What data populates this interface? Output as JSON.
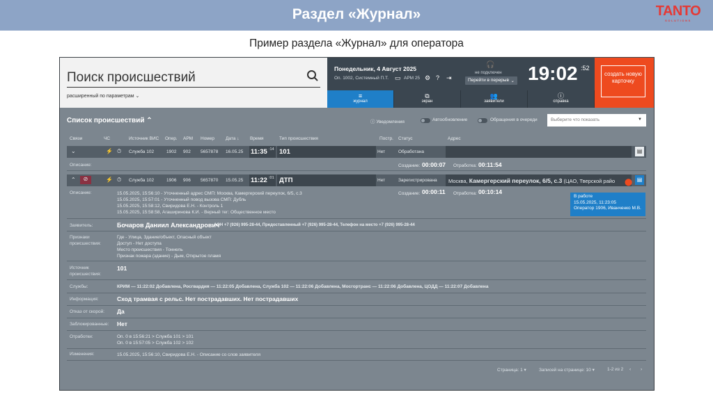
{
  "slide": {
    "title": "Раздел «Журнал»",
    "subtitle": "Пример раздела «Журнал» для оператора",
    "brand": "TANTO",
    "brand_sub": "SOLUTIONS"
  },
  "header": {
    "search_title": "Поиск происшествий",
    "advanced_search": "расширенный по параметрам",
    "date": "Понедельник, 4 Август 2025",
    "operator": "Оп. 1002, Системный П.Т.",
    "arm": "АРМ 25",
    "headset_status": "не подключен",
    "pause_label": "Перейти в перерыв",
    "clock_hm": "19:02",
    "clock_sec": ":52",
    "create_card": "создать новую карточку"
  },
  "tabs": [
    {
      "label": "журнал",
      "icon": "list-icon",
      "active": true
    },
    {
      "label": "экран",
      "icon": "external-screen-icon",
      "active": false
    },
    {
      "label": "заявители",
      "icon": "users-icon",
      "active": false
    },
    {
      "label": "справка",
      "icon": "help-icon",
      "active": false
    }
  ],
  "list": {
    "title": "Список происшествий",
    "notifications": "Уведомления",
    "autoupdate": "Автообновление",
    "queue": "Обращения в очереди",
    "select_placeholder": "Выберите что показать"
  },
  "columns": [
    "Связи",
    "ЧС",
    "Источник ВИС",
    "Опер.",
    "АРМ",
    "Номер",
    "Дата",
    "Время",
    "Тип происшествия",
    "Постр.",
    "Статус",
    "Адрес"
  ],
  "row1": {
    "source": "Служба 102",
    "oper": "1902",
    "arm": "902",
    "number": "5657878",
    "date": "16.05.25",
    "time": "11:35",
    "time_sec": ":14",
    "type": "101",
    "postr": "Нет",
    "status": "Обработана",
    "desc_label": "Описание:",
    "created_label": "Создание:",
    "created": "00:00:07",
    "processing_label": "Отработка:",
    "processing": "00:11:54"
  },
  "row2": {
    "source": "Служба 102",
    "oper": "1906",
    "arm": "906",
    "number": "5657870",
    "date": "15.05.25",
    "time": "11:22",
    "time_sec": ":01",
    "type": "ДТП",
    "postr": "Нет",
    "status": "Зарегистрирована",
    "address_prefix": "Москва,",
    "address_main": "Камергерский переулок, 6/5, с.3",
    "address_suffix": "(ЦАО, Тверской райо",
    "created_label": "Создание:",
    "created": "00:00:11",
    "processing_label": "Отработка:",
    "processing": "00:10:14",
    "tooltip": [
      "В работе",
      "15.05.2025, 11:23:05",
      "Оператор 1906, Иванченко М.В."
    ],
    "desc_label": "Описание:",
    "desc_lines": [
      "15.05.2025, 15:56:10 - Уточненный адрес СМП: Москва, Камергерский переулок, 6/5, с.3",
      "15.05.2025, 15:57:01 - Уточненный повод вызова СМП: Дубль",
      "15.05.2025, 15:58:12, Свиридова Е.Н. - Контроль 1",
      "15.05.2025, 15:58:58, Агаширинова К.И. - Верный тег: Общественное место"
    ],
    "applicant_label": "Заявитель:",
    "applicant": "Бочаров Даниил Александрович",
    "applicant_phones": "АОН +7 (926) 995-28-44, Предоставленный +7 (926) 995-28-44, Телефон на место +7 (926) 995-28-44",
    "signs_label": "Признаки происшествия:",
    "signs": [
      "Где - Улица, Здание/объект, Опасный объект",
      "Доступ - Нет доступа",
      "Место происшествия - Тоннель",
      "Признак пожара (здание) - Дым, Открытое пламя"
    ],
    "source_label": "Источник происшествия:",
    "source_value": "101",
    "services_label": "Службы:",
    "services": "КРИМ — 11:22:02 Добавлена, Росгвардия — 11:22:05 Добавлена, Служба 102 — 11:22:06 Добавлена, Мосгортранс — 11:22:06 Добавлена, ЦОДД — 11:22:07 Добавлена",
    "info_label": "Информация:",
    "info": "Сход трамвая с рельс. Нет пострадавших. Нет пострадавших",
    "ambulance_label": "Отказ от скорой:",
    "ambulance": "Да",
    "blocked_label": "Заблокированные:",
    "blocked": "Нет",
    "processing2_label": "Отработки:",
    "processing2": [
      "Оп. 0 в 15:56:21 > Служба 101 > 101",
      "Оп. 0 в 15:57:05 > Служба 102 > 102"
    ],
    "changes_label": "Изменения:",
    "changes": "15.05.2025, 15:56:10, Свиридова Е.Н. - Описание со слов заявителя"
  },
  "pager": {
    "page": "Страница: 1",
    "per_page": "Записей на странице: 10",
    "range": "1-2 из 2"
  },
  "colors": {
    "accent": "#1f7fc8",
    "create": "#ee4a1f",
    "header": "#8da4c6",
    "panel": "#7c868f"
  }
}
